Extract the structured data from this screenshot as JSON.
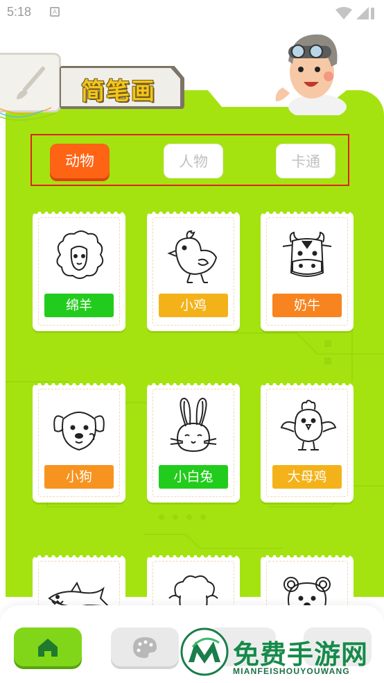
{
  "status_bar": {
    "time": "5:18",
    "notification_letter": "A"
  },
  "header": {
    "title": "简笔画"
  },
  "tabs": [
    {
      "label": "动物",
      "active": true
    },
    {
      "label": "人物",
      "active": false
    },
    {
      "label": "卡通",
      "active": false
    }
  ],
  "cards": [
    {
      "label": "绵羊",
      "color": "#22cc1c",
      "icon": "sheep-drawing-icon"
    },
    {
      "label": "小鸡",
      "color": "#f4b21a",
      "icon": "chick-drawing-icon"
    },
    {
      "label": "奶牛",
      "color": "#f7841f",
      "icon": "cow-drawing-icon"
    },
    {
      "label": "小狗",
      "color": "#f7931f",
      "icon": "dog-drawing-icon"
    },
    {
      "label": "小白兔",
      "color": "#22cc1c",
      "icon": "rabbit-drawing-icon"
    },
    {
      "label": "大母鸡",
      "color": "#f4b21a",
      "icon": "hen-drawing-icon"
    },
    {
      "label": "",
      "color": "",
      "icon": "shark-drawing-icon"
    },
    {
      "label": "",
      "color": "",
      "icon": "lamb-drawing-icon"
    },
    {
      "label": "",
      "color": "",
      "icon": "bear-drawing-icon"
    }
  ],
  "bottom_nav": {
    "items": [
      {
        "icon": "home-icon",
        "active": true
      },
      {
        "icon": "palette-icon",
        "active": false
      },
      {
        "icon": "more-icon",
        "active": false
      },
      {
        "icon": "profile-icon",
        "active": false
      }
    ]
  },
  "watermark": {
    "title": "免费手游网",
    "subtitle": "MIANFEISHOUYOUWANG"
  },
  "colors": {
    "panel_green": "#a4e30f",
    "active_tab": "#ff6314",
    "tab_box_border": "#e0201c"
  }
}
